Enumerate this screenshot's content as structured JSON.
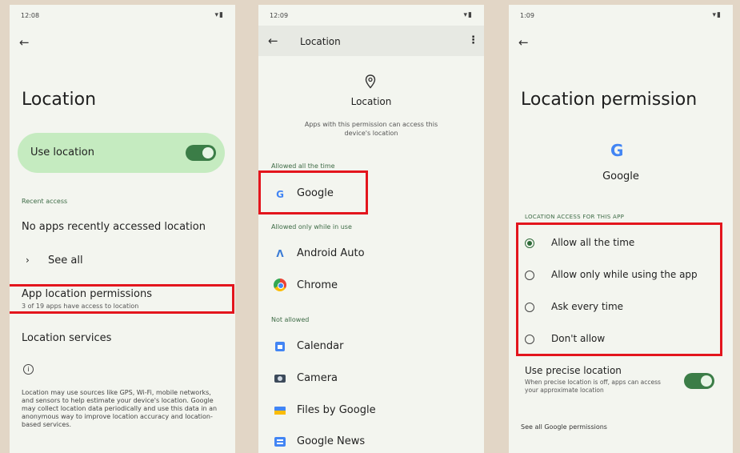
{
  "screen1": {
    "time": "12:08",
    "title": "Location",
    "use_location": "Use location",
    "recent_access": "Recent access",
    "no_apps": "No apps recently accessed location",
    "see_all": "See all",
    "app_perms_title": "App location permissions",
    "app_perms_sub": "3 of 19 apps have access to location",
    "location_services": "Location services",
    "info_text": "Location may use sources like GPS, Wi-Fi, mobile networks, and sensors to help estimate your device's location. Google may collect location data periodically and use this data in an anonymous way to improve location accuracy and location-based services."
  },
  "screen2": {
    "time": "12:09",
    "appbar_title": "Location",
    "header_title": "Location",
    "header_desc": "Apps with this permission can access this device's location",
    "section_all": "Allowed all the time",
    "section_while": "Allowed only while in use",
    "section_not": "Not allowed",
    "apps_all": [
      {
        "label": "Google",
        "icon": "google-icon"
      }
    ],
    "apps_while": [
      {
        "label": "Android Auto",
        "icon": "android-auto-icon"
      },
      {
        "label": "Chrome",
        "icon": "chrome-icon"
      }
    ],
    "apps_not": [
      {
        "label": "Calendar",
        "icon": "calendar-icon"
      },
      {
        "label": "Camera",
        "icon": "camera-icon"
      },
      {
        "label": "Files by Google",
        "icon": "files-icon"
      },
      {
        "label": "Google News",
        "icon": "news-icon"
      }
    ]
  },
  "screen3": {
    "time": "1:09",
    "title": "Location permission",
    "app_name": "Google",
    "section": "LOCATION ACCESS FOR THIS APP",
    "options": [
      "Allow all the time",
      "Allow only while using the app",
      "Ask every time",
      "Don't allow"
    ],
    "selected_option": "Allow all the time",
    "precise_title": "Use precise location",
    "precise_desc": "When precise location is off, apps can access your approximate location",
    "see_all_perms": "See all Google permissions"
  },
  "colors": {
    "highlight": "#e3151d",
    "accent_green": "#3b7d47",
    "use_location_bg": "#c5ebc0"
  }
}
